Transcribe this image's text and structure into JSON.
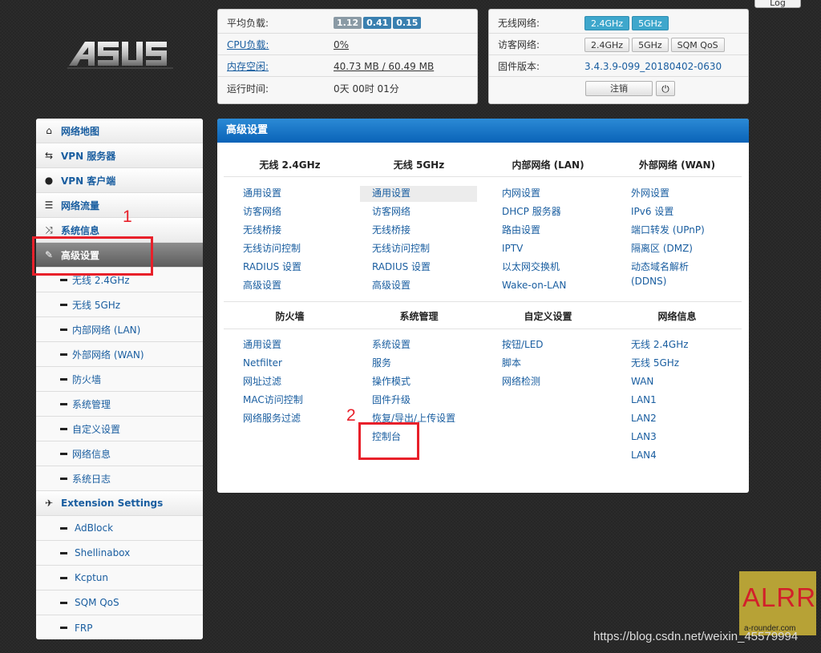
{
  "topbar": {
    "logout_tab": "Log"
  },
  "logo": {
    "text": "ASUS"
  },
  "status_left": {
    "rows": [
      {
        "label": "平均负载:",
        "values": [
          "1.12",
          "0.41",
          "0.15"
        ]
      },
      {
        "label": "CPU负载:",
        "value": "0%"
      },
      {
        "label": "内存空闲:",
        "value": "40.73 MB / 60.49 MB"
      },
      {
        "label": "运行时间:",
        "value": "0天 00时 01分"
      }
    ]
  },
  "status_right": {
    "wireless_label": "无线网络:",
    "wireless_bands": [
      "2.4GHz",
      "5GHz"
    ],
    "guest_label": "访客网络:",
    "guest_buttons": [
      "2.4GHz",
      "5GHz",
      "SQM QoS"
    ],
    "firmware_label": "固件版本:",
    "firmware_value": "3.4.3.9-099_20180402-0630",
    "logout_button": "注销",
    "power_icon": "power-icon"
  },
  "sidebar": {
    "items": [
      {
        "label": "网络地图",
        "icon": "home-icon"
      },
      {
        "label": "VPN 服务器",
        "icon": "retweet-icon"
      },
      {
        "label": "VPN 客户端",
        "icon": "globe-icon"
      },
      {
        "label": "网络流量",
        "icon": "list-icon"
      },
      {
        "label": "系统信息",
        "icon": "random-icon"
      },
      {
        "label": "高级设置",
        "icon": "wrench-icon",
        "active": true
      }
    ],
    "sub_items": [
      "无线 2.4GHz",
      "无线 5GHz",
      "内部网络 (LAN)",
      "外部网络 (WAN)",
      "防火墙",
      "系统管理",
      "自定义设置",
      "网络信息",
      "系统日志"
    ],
    "extension": {
      "label": "Extension Settings",
      "icon": "plane-icon"
    },
    "extension_items": [
      "AdBlock",
      "Shellinabox",
      "Kcptun",
      "SQM QoS",
      "FRP"
    ]
  },
  "main": {
    "title": "高级设置",
    "sections_top": [
      {
        "head": "无线 2.4GHz",
        "links": [
          "通用设置",
          "访客网络",
          "无线桥接",
          "无线访问控制",
          "RADIUS 设置",
          "高级设置"
        ]
      },
      {
        "head": "无线 5GHz",
        "links": [
          "通用设置",
          "访客网络",
          "无线桥接",
          "无线访问控制",
          "RADIUS 设置",
          "高级设置"
        ]
      },
      {
        "head": "内部网络 (LAN)",
        "links": [
          "内网设置",
          "DHCP 服务器",
          "路由设置",
          "IPTV",
          "以太网交换机",
          "Wake-on-LAN"
        ]
      },
      {
        "head": "外部网络 (WAN)",
        "links": [
          "外网设置",
          "IPv6 设置",
          "端口转发 (UPnP)",
          "隔离区 (DMZ)",
          "动态域名解析",
          "(DDNS)"
        ]
      }
    ],
    "sections_bottom": [
      {
        "head": "防火墙",
        "links": [
          "通用设置",
          "Netfilter",
          "网址过滤",
          "MAC访问控制",
          "网络服务过滤"
        ]
      },
      {
        "head": "系统管理",
        "links": [
          "系统设置",
          "服务",
          "操作模式",
          "固件升级",
          "恢复/导出/上传设置",
          "控制台"
        ]
      },
      {
        "head": "自定义设置",
        "links": [
          "按钮/LED",
          "脚本",
          "网络检测"
        ]
      },
      {
        "head": "网络信息",
        "links": [
          "无线 2.4GHz",
          "无线 5GHz",
          "WAN",
          "LAN1",
          "LAN2",
          "LAN3",
          "LAN4"
        ]
      }
    ]
  },
  "annotations": {
    "step1": "1",
    "step2": "2"
  },
  "watermark": {
    "badge": "ALRR",
    "badge_sub": "a-rounder.com",
    "url": "https://blog.csdn.net/weixin_45579994"
  },
  "colors": {
    "accent": "#0a63b8",
    "link": "#1a5ea0",
    "annotation": "#e8202a",
    "active_band": "#3ea7cc"
  }
}
